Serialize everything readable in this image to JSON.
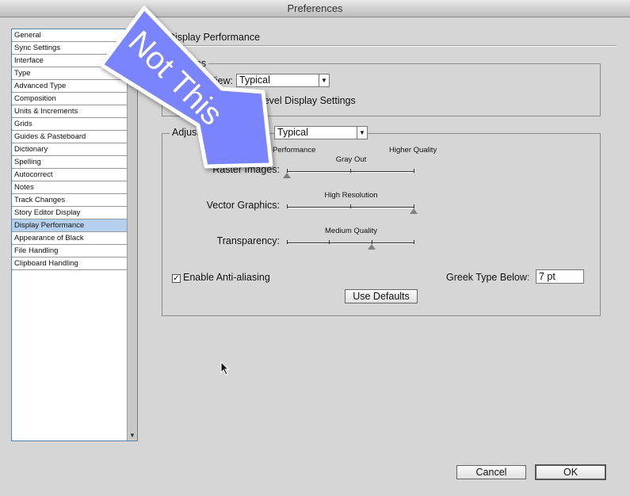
{
  "window": {
    "title": "Preferences"
  },
  "sidebar": {
    "items": [
      "General",
      "Sync Settings",
      "Interface",
      "Type",
      "Advanced Type",
      "Composition",
      "Units & Increments",
      "Grids",
      "Guides & Pasteboard",
      "Dictionary",
      "Spelling",
      "Autocorrect",
      "Notes",
      "Track Changes",
      "Story Editor Display",
      "Display Performance",
      "Appearance of Black",
      "File Handling",
      "Clipboard Handling"
    ],
    "selected": "Display Performance"
  },
  "main": {
    "section_title": "Display Performance",
    "options": {
      "title": "Options",
      "default_view_label": "Default View:",
      "default_view_value": "Typical",
      "preserve_label": "Preserve Object-Level Display Settings"
    },
    "adjust": {
      "title": "Adjust View Settings:",
      "view_value": "Typical",
      "left_label": "Better Performance",
      "right_label": "Higher Quality",
      "sliders": [
        {
          "label": "Raster Images:",
          "value_label": "Gray Out",
          "ticks": 3,
          "level": 0
        },
        {
          "label": "Vector Graphics:",
          "value_label": "High Resolution",
          "ticks": 3,
          "level": 1
        },
        {
          "label": "Transparency:",
          "value_label": "Medium Quality",
          "ticks": 4,
          "level": 0.667
        }
      ],
      "anti_aliasing": {
        "label": "Enable Anti-aliasing",
        "checked": true
      },
      "greek_label": "Greek Type Below:",
      "greek_value": "7 pt",
      "defaults_button": "Use Defaults"
    }
  },
  "footer": {
    "cancel": "Cancel",
    "ok": "OK"
  },
  "overlay": {
    "text": "Not This",
    "color": "#7b84ff"
  }
}
